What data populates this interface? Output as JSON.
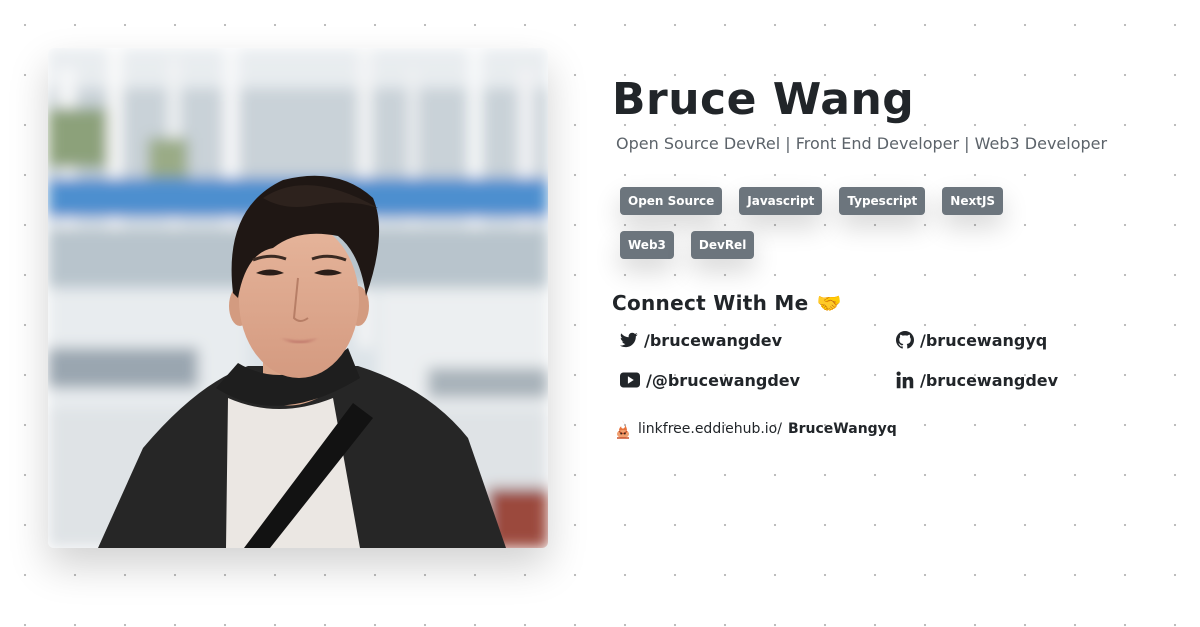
{
  "profile": {
    "name": "Bruce Wang",
    "tagline": "Open Source DevRel | Front End Developer | Web3 Developer",
    "photo_icon": "profile-photo"
  },
  "tags": [
    "Open Source",
    "Javascript",
    "Typescript",
    "NextJS",
    "Web3",
    "DevRel"
  ],
  "connect": {
    "title": "Connect With Me",
    "emoji": "🤝",
    "links": {
      "twitter": {
        "label": "/brucewangdev",
        "icon": "twitter-icon"
      },
      "github": {
        "label": "/brucewangyq",
        "icon": "github-icon"
      },
      "youtube": {
        "label": "/@brucewangdev",
        "icon": "youtube-icon"
      },
      "linkedin": {
        "label": "/brucewangdev",
        "icon": "linkedin-icon"
      }
    }
  },
  "linkfree": {
    "prefix": "linkfree.eddiehub.io/",
    "username": "BruceWangyq",
    "icon": "linkfree-logo-icon"
  },
  "colors": {
    "text": "#212529",
    "muted": "#5c636a",
    "tag_bg": "#6c757d"
  }
}
